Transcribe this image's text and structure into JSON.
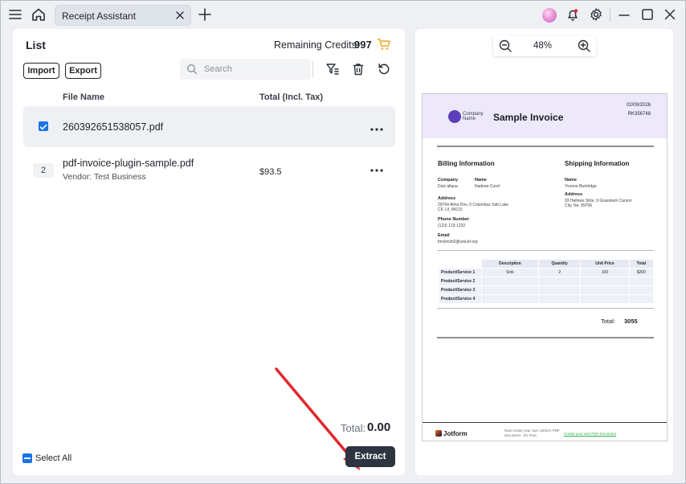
{
  "titlebar": {
    "tab_title": "Receipt Assistant",
    "icons": [
      "menu-icon",
      "home-icon",
      "close-icon",
      "plus-icon",
      "avatar",
      "bell-icon",
      "gear-icon",
      "minimize-icon",
      "maximize-icon",
      "close-window-icon"
    ]
  },
  "list": {
    "title": "List",
    "credits_label": "Remaining Credits:",
    "credits_value": "997",
    "import_label": "Import",
    "export_label": "Export",
    "search_placeholder": "Search",
    "columns": {
      "file_name": "File Name",
      "total": "Total (Incl. Tax)"
    },
    "rows": [
      {
        "selected": true,
        "number": "",
        "file_name": "260392651538057.pdf",
        "vendor": "",
        "amount": ""
      },
      {
        "selected": false,
        "number": "2",
        "file_name": "pdf-invoice-plugin-sample.pdf",
        "vendor": "Vendor: Test Business",
        "amount": "$93.5"
      }
    ],
    "total_label": "Total:",
    "total_value": "0.00",
    "select_all_label": "Select All",
    "extract_label": "Extract"
  },
  "preview": {
    "zoom_value": "48%",
    "invoice": {
      "logo_text": "Company Name",
      "title": "Sample Invoice",
      "date": "02/09/2026",
      "number": "RK356748",
      "billing_title": "Billing Information",
      "shipping_title": "Shipping Information",
      "company_label": "Company",
      "company_value": "Duis aliqua",
      "name_label": "Name",
      "billing_name": "Nadean Cund",
      "address_label": "Address",
      "billing_address": "29764 Almu Driv, 0 Columbus Salt Lake CII, UI, 84115",
      "phone_label": "Phone Number",
      "phone_value": "(123) 123-1232",
      "email_label": "Email",
      "email_value": "tmcknish2@unicef.org",
      "shipping_name": "Yvonne Burbridge",
      "shipping_address": "93 Hallows Strte, 9 Grasskam Carson City, Ne, 89706",
      "table_headers": [
        "Description",
        "Quantity",
        "Unit Price",
        "Total"
      ],
      "table_rows": [
        {
          "product": "Product/Service 1",
          "description": "Sink",
          "quantity": "2",
          "unit_price": "100",
          "total": "$200"
        },
        {
          "product": "Product/Service 2",
          "description": "",
          "quantity": "",
          "unit_price": "",
          "total": ""
        },
        {
          "product": "Product/Service 3",
          "description": "",
          "quantity": "",
          "unit_price": "",
          "total": ""
        },
        {
          "product": "Product/Service 4",
          "description": "",
          "quantity": "",
          "unit_price": "",
          "total": ""
        }
      ],
      "total_label": "Total:",
      "total_value": "3055",
      "footer_brand": "Jotform",
      "footer_text": "Now create your own Jotform PDF document - It's Free",
      "footer_link": "Create your own PDF Document"
    }
  },
  "colors": {
    "accent": "#1a73e8",
    "extract_bg": "#2f3441",
    "cart": "#f5a623",
    "annotation_arrow": "#e0282e",
    "invoice_header": "#ede9fb"
  }
}
